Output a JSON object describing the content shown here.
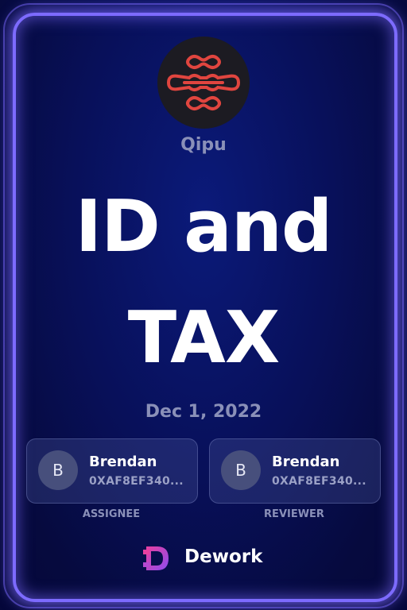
{
  "org": {
    "name": "Qipu",
    "logo_icon": "qipu-knot-logo",
    "logo_color": "#e0453f"
  },
  "task": {
    "title_line1": "ID and",
    "title_line2": "TAX",
    "date": "Dec 1, 2022"
  },
  "assignee": {
    "avatar_letter": "B",
    "name": "Brendan",
    "address": "0XAF8EF340...",
    "role_label": "ASSIGNEE"
  },
  "reviewer": {
    "avatar_letter": "B",
    "name": "Brendan",
    "address": "0XAF8EF340...",
    "role_label": "REVIEWER"
  },
  "brand": {
    "name": "Dework",
    "logo_icon": "dework-logo",
    "gradient": [
      "#e83fa0",
      "#8a4cf0"
    ]
  },
  "colors": {
    "frame_glow": "#7d6bff",
    "background": "#08105a",
    "muted_text": "#8a90b8"
  }
}
